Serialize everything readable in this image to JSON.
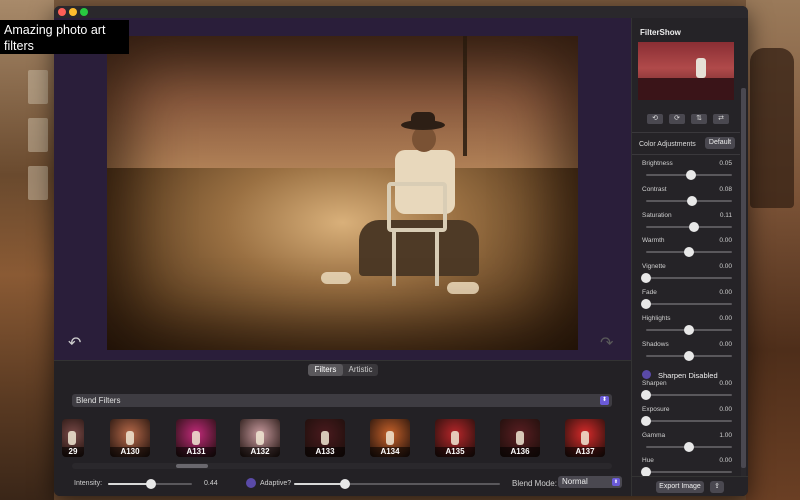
{
  "caption": "Amazing photo art filters",
  "window": {
    "controls": [
      "close",
      "minimize",
      "zoom"
    ]
  },
  "canvas": {
    "undo_icon": "undo-icon",
    "redo_icon": "redo-icon"
  },
  "tabs": [
    {
      "label": "Filters",
      "selected": true
    },
    {
      "label": "Artistic",
      "selected": false
    }
  ],
  "filter_category": "Blend Filters",
  "thumbnails": [
    {
      "label": "29",
      "color": "#7a4a48"
    },
    {
      "label": "A130",
      "color": "#b86a4a"
    },
    {
      "label": "A131",
      "color": "#c22a7a"
    },
    {
      "label": "A132",
      "color": "#c89a9e"
    },
    {
      "label": "A133",
      "color": "#4a1a1e"
    },
    {
      "label": "A134",
      "color": "#c8622a"
    },
    {
      "label": "A135",
      "color": "#b8262a"
    },
    {
      "label": "A136",
      "color": "#5a1e22"
    },
    {
      "label": "A137",
      "color": "#d82a2a"
    }
  ],
  "intensity": {
    "label": "Intensity:",
    "value": "0.44"
  },
  "adaptive": {
    "label": "Adaptive?",
    "checked": true
  },
  "blend_mode": {
    "label": "Blend Mode:",
    "value": "Normal"
  },
  "sidebar": {
    "title": "FilterShow",
    "tools": [
      "rotate-left-icon",
      "rotate-right-icon",
      "flip-vertical-icon",
      "flip-horizontal-icon"
    ],
    "section_label": "Color Adjustments",
    "default_button": "Default",
    "adjustments": [
      {
        "name": "Brightness",
        "value": "0.05"
      },
      {
        "name": "Contrast",
        "value": "0.08"
      },
      {
        "name": "Saturation",
        "value": "0.11"
      },
      {
        "name": "Warmth",
        "value": "0.00"
      },
      {
        "name": "Vignette",
        "value": "0.00"
      },
      {
        "name": "Fade",
        "value": "0.00"
      },
      {
        "name": "Highlights",
        "value": "0.00"
      },
      {
        "name": "Shadows",
        "value": "0.00"
      }
    ],
    "sharpen_toggle": "Sharpen Disabled",
    "adjustments2": [
      {
        "name": "Sharpen",
        "value": "0.00"
      },
      {
        "name": "Exposure",
        "value": "0.00"
      },
      {
        "name": "Gamma",
        "value": "1.00"
      },
      {
        "name": "Hue",
        "value": "0.00"
      }
    ],
    "export_button": "Export Image"
  },
  "colors": {
    "accent": "#6a5ad8",
    "window_bg": "#1f1d21"
  }
}
